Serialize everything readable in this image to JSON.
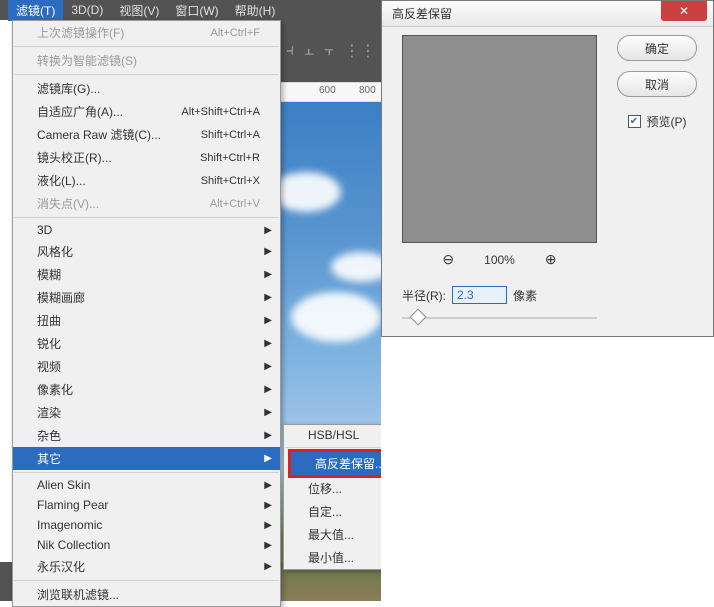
{
  "menubar": {
    "items": [
      "滤镜(T)",
      "3D(D)",
      "视图(V)",
      "窗口(W)",
      "帮助(H)"
    ]
  },
  "ruler": {
    "t1": "600",
    "t2": "800"
  },
  "dropdown": {
    "recent": {
      "label": "上次滤镜操作(F)",
      "short": "Alt+Ctrl+F"
    },
    "smart": "转换为智能滤镜(S)",
    "g1": [
      {
        "label": "滤镜库(G)...",
        "short": ""
      },
      {
        "label": "自适应广角(A)...",
        "short": "Alt+Shift+Ctrl+A"
      },
      {
        "label": "Camera Raw 滤镜(C)...",
        "short": "Shift+Ctrl+A"
      },
      {
        "label": "镜头校正(R)...",
        "short": "Shift+Ctrl+R"
      },
      {
        "label": "液化(L)...",
        "short": "Shift+Ctrl+X"
      },
      {
        "label": "消失点(V)...",
        "short": "Alt+Ctrl+V",
        "disabled": true
      }
    ],
    "g2": [
      "3D",
      "风格化",
      "模糊",
      "模糊画廊",
      "扭曲",
      "锐化",
      "视频",
      "像素化",
      "渲染",
      "杂色",
      "其它"
    ],
    "g3": [
      "Alien Skin",
      "Flaming Pear",
      "Imagenomic",
      "Nik Collection",
      "永乐汉化"
    ],
    "g4": "浏览联机滤镜..."
  },
  "submenu": {
    "top": "HSB/HSL",
    "hl": "高反差保留...",
    "rest": [
      "位移...",
      "自定...",
      "最大值...",
      "最小值..."
    ]
  },
  "dialog": {
    "title": "高反差保留",
    "ok": "确定",
    "cancel": "取消",
    "preview_label": "预览(P)",
    "zoom": "100%",
    "radius_label": "半径(R):",
    "radius_value": "2.3",
    "radius_unit": "像素"
  }
}
